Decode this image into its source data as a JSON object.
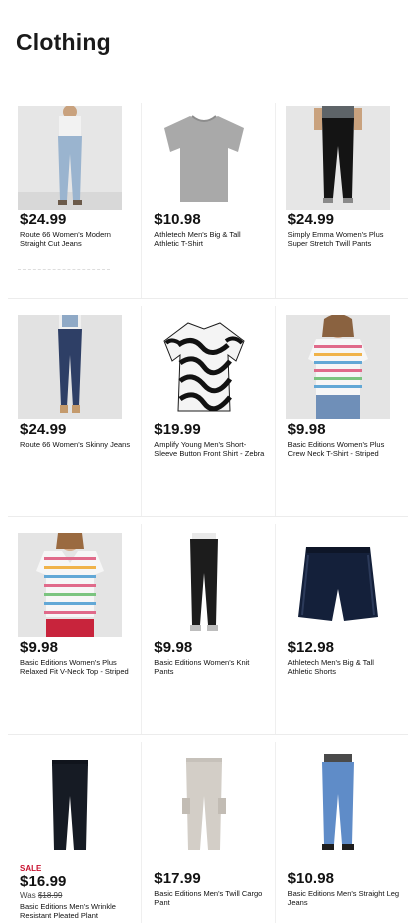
{
  "page": {
    "title": "Clothing"
  },
  "products": [
    {
      "price": "$24.99",
      "name": "Route 66 Women's Modern Straight Cut Jeans",
      "image": "light-jeans-woman"
    },
    {
      "price": "$10.98",
      "name": "Athletech Men's Big & Tall Athletic T-Shirt",
      "image": "gray-tshirt"
    },
    {
      "price": "$24.99",
      "name": "Simply Emma Women's Plus Super Stretch Twill Pants",
      "image": "black-pants-woman"
    },
    {
      "price": "$24.99",
      "name": "Route 66 Women's Skinny Jeans",
      "image": "skinny-jeans-woman"
    },
    {
      "price": "$19.99",
      "name": "Amplify Young Men's Short-Sleeve Button Front Shirt - Zebra",
      "image": "zebra-shirt"
    },
    {
      "price": "$9.98",
      "name": "Basic Editions Women's Plus Crew Neck T-Shirt - Striped",
      "image": "striped-tee-model"
    },
    {
      "price": "$9.98",
      "name": "Basic Editions Women's Plus Relaxed Fit V-Neck Top - Striped",
      "image": "striped-vneck-model"
    },
    {
      "price": "$9.98",
      "name": "Basic Editions Women's Knit Pants",
      "image": "knit-pants-woman"
    },
    {
      "price": "$12.98",
      "name": "Athletech Men's Big & Tall Athletic Shorts",
      "image": "navy-shorts"
    },
    {
      "sale_label": "SALE",
      "price": "$16.99",
      "was_label": "Was",
      "was_price": "$18.99",
      "name": "Basic Editions Men's Wrinkle Resistant Pleated Plant",
      "image": "black-pleated-pants"
    },
    {
      "price": "$17.99",
      "name": "Basic Editions Men's Twill Cargo Pant",
      "image": "khaki-cargo-pants"
    },
    {
      "price": "$10.98",
      "name": "Basic Editions Men's Straight Leg Jeans",
      "image": "blue-jeans-man"
    }
  ]
}
